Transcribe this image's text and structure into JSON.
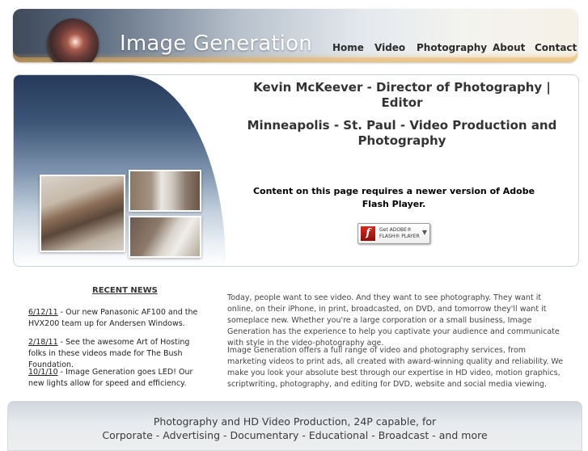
{
  "brand": {
    "name": "Image Generation"
  },
  "nav": {
    "items": [
      "Home",
      "Video",
      "Photography",
      "About",
      "Contact"
    ]
  },
  "hero": {
    "title": "Kevin McKeever - Director of Photography | Editor",
    "subtitle": "Minneapolis - St. Paul - Video Production and Photography",
    "flash_notice": "Content on this page requires a newer version of Adobe Flash Player.",
    "flash_badge": {
      "line1": "Get ADOBE®",
      "line2": "FLASH® PLAYER"
    }
  },
  "news": {
    "heading": "RECENT NEWS",
    "items": [
      {
        "date": "6/12/11",
        "text": " - Our new Panasonic AF100 and the HVX200 team up for Andersen Windows."
      },
      {
        "date": "2/18/11",
        "text": " - See the awesome Art of Hosting folks in these videos made for The Bush Foundation."
      },
      {
        "date": "10/1/10",
        "text": " - Image Generation goes LED! Our new lights allow for speed and efficiency."
      }
    ]
  },
  "intro": {
    "paragraphs": [
      "Today, people want to see video. And they want to see photography. They want it online, on their iPhone, in print, broadcasted, on DVD, and tomorrow they'll want it someplace new. Whether you're a large corporation or a small business, Image Generation has the experience to help you captivate your audience and communicate with style in the video-photography age.",
      "Image Generation offers a full range of video and photography services, from marketing videos to print ads, all created with award-winning quality and reliability. We make you look your absolute best through our expertise in HD video, motion graphics, scriptwriting, photography, and editing for DVD, website and social media viewing."
    ]
  },
  "footer": {
    "line1": "Photography and HD Video Production, 24P capable, for",
    "line2": "Corporate - Advertising - Documentary - Educational - Broadcast - and more"
  },
  "colors": {
    "header_dark": "#3f4a59",
    "header_light": "#f5f1e6",
    "accent_glow": "#eaac4f",
    "panel_blue": "#263a5b",
    "text": "#333333"
  },
  "icons": {
    "logo": "camera-lens-icon",
    "flash": "adobe-flash-icon",
    "download": "arrow-down-icon"
  }
}
